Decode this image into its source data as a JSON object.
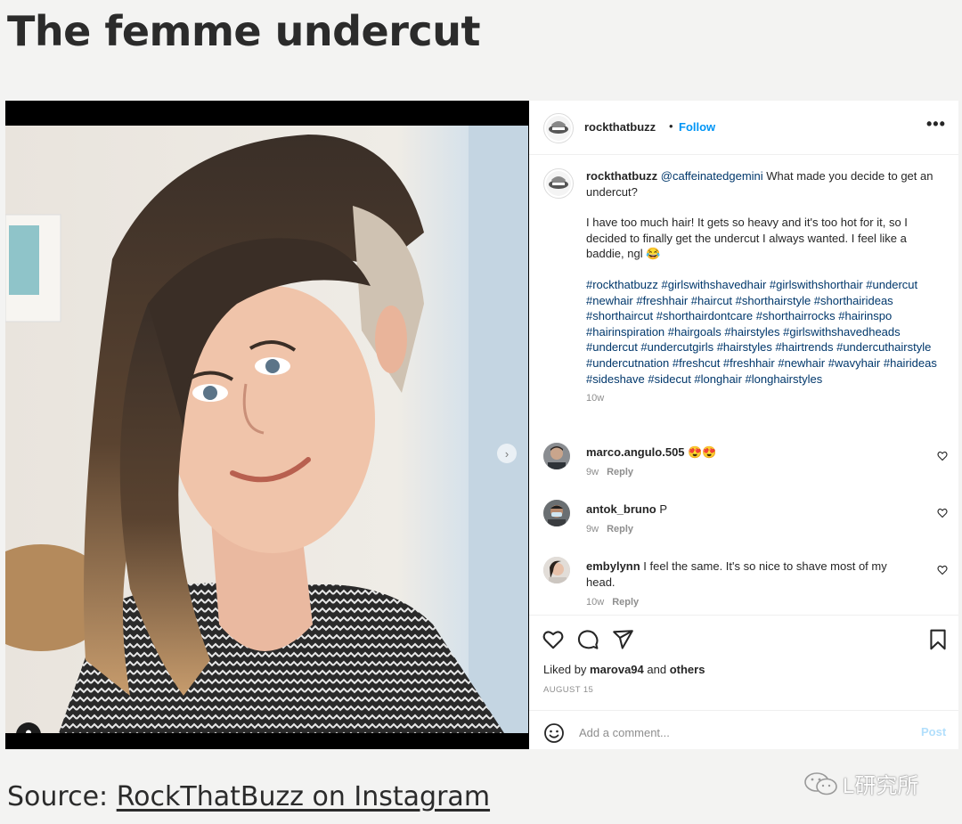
{
  "article": {
    "title": "The femme undercut",
    "source_prefix": "Source: ",
    "source_link": "RockThatBuzz on Instagram",
    "watermark": "L研究所"
  },
  "post": {
    "username": "rockthatbuzz",
    "dot": "•",
    "follow_label": "Follow",
    "more_label": "•••",
    "caption": {
      "username": "rockthatbuzz",
      "mention": "@caffeinatedgemini",
      "question": " What made you decide to get an undercut?",
      "body": "I have too much hair! It gets so heavy and it's too hot for it, so I decided to finally get the undercut I always wanted. I feel like a baddie, ngl 😂",
      "hashtags": "#rockthatbuzz #girlswithshavedhair #girlswithshorthair #undercut #newhair #freshhair #haircut #shorthairstyle #shorthairideas #shorthaircut #shorthairdontcare #shorthairrocks #hairinspo #hairinspiration #hairgoals #hairstyles #girlswithshavedheads #undercut #undercutgirls #hairstyles #hairtrends #undercuthairstyle #undercutnation #freshcut #freshhair #newhair #wavyhair #hairideas #sideshave #sidecut #longhair #longhairstyles",
      "time": "10w"
    },
    "comments": [
      {
        "user": "marco.angulo.505",
        "text": " 😍😍",
        "time": "9w",
        "reply": "Reply"
      },
      {
        "user": "antok_bruno",
        "text": " P",
        "time": "9w",
        "reply": "Reply"
      },
      {
        "user": "embylynn",
        "text": " I feel the same. It's so nice to shave most of my head.",
        "time": "10w",
        "reply": "Reply"
      }
    ],
    "likes": {
      "prefix": "Liked by ",
      "user": "marova94",
      "middle": " and ",
      "others": "others"
    },
    "date": "AUGUST 15",
    "add_comment_placeholder": "Add a comment...",
    "post_label": "Post",
    "next_arrow": "›"
  },
  "colors": {
    "link": "#00376b",
    "follow": "#0095f6",
    "post_disabled": "#b2dffc",
    "meta": "#8e8e8e"
  }
}
